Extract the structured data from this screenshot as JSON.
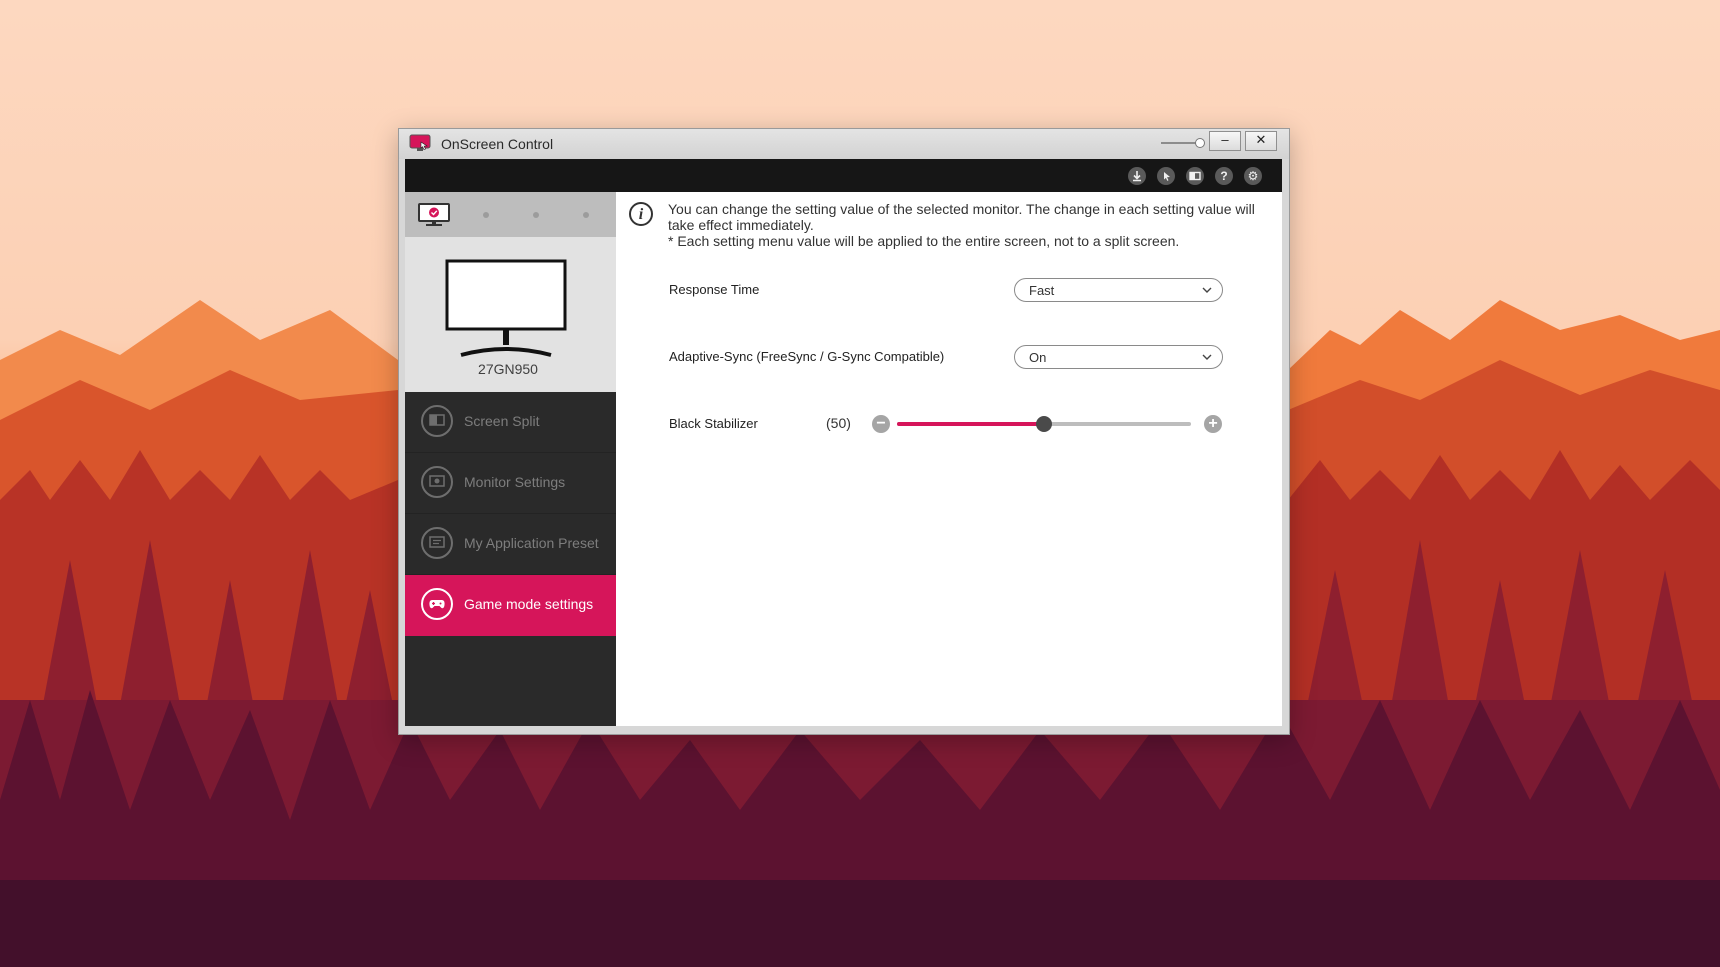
{
  "window": {
    "title": "OnScreen Control",
    "opacity_level": 1.0,
    "minimize_glyph": "–",
    "close_glyph": "✕"
  },
  "toolbar": {
    "icons": [
      "download-icon",
      "cursor-icon",
      "screen-icon",
      "help-icon",
      "settings-icon"
    ],
    "help_glyph": "?",
    "settings_glyph": "⚙"
  },
  "sidebar": {
    "monitor_model": "27GN950",
    "nav_items": [
      {
        "label": "Screen Split",
        "icon": "screen-split-icon"
      },
      {
        "label": "Monitor Settings",
        "icon": "monitor-settings-icon"
      },
      {
        "label": "My Application Preset",
        "icon": "app-preset-icon"
      },
      {
        "label": "Game mode settings",
        "icon": "gamepad-icon",
        "active": true
      }
    ]
  },
  "content": {
    "info_glyph": "i",
    "info_line1": "You can change the setting value of the selected monitor. The change in each setting value will take effect immediately.",
    "info_line2": "* Each setting menu value will be applied to the entire screen, not to a split screen.",
    "settings": {
      "response_time": {
        "label": "Response Time",
        "value": "Fast"
      },
      "adaptive_sync": {
        "label": "Adaptive-Sync (FreeSync / G-Sync Compatible)",
        "value": "On"
      },
      "black_stabilizer": {
        "label": "Black Stabilizer",
        "readout": "(50)",
        "value": 50,
        "min": 0,
        "max": 100,
        "minus_glyph": "−",
        "plus_glyph": "+"
      }
    }
  },
  "colors": {
    "accent": "#d6155a",
    "sidebar_bg": "#2a2a2a",
    "toolbar_bg": "#161616"
  }
}
